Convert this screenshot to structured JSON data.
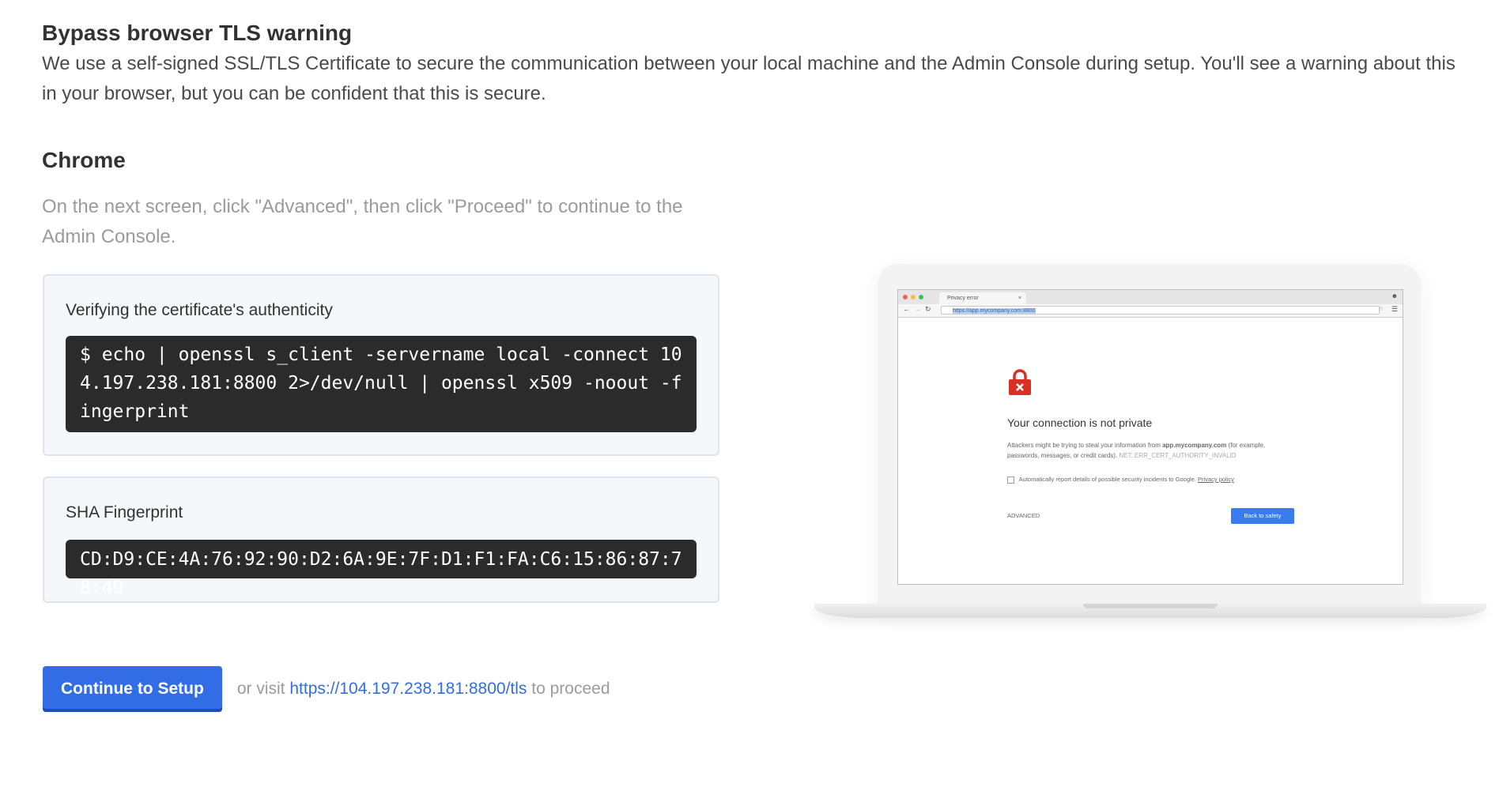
{
  "header": {
    "title": "Bypass browser TLS warning",
    "intro": "We use a self-signed SSL/TLS Certificate to secure the communication between your local machine and the Admin Console during setup. You'll see a warning about this in your browser, but you can be confident that this is secure."
  },
  "browser_section": {
    "title": "Chrome",
    "instructions": "On the next screen, click \"Advanced\", then click \"Proceed\" to continue to the Admin Console."
  },
  "verify_card": {
    "title": "Verifying the certificate's authenticity",
    "command": "$ echo | openssl s_client -servername local -connect 104.197.238.181:8800 2>/dev/null | openssl x509 -noout -fingerprint"
  },
  "fingerprint_card": {
    "title": "SHA Fingerprint",
    "value": "CD:D9:CE:4A:76:92:90:D2:6A:9E:7F:D1:F1:FA:C6:15:86:87:78:49"
  },
  "actions": {
    "continue_label": "Continue to Setup",
    "or_visit": "or visit",
    "link_text": "https://104.197.238.181:8800/tls",
    "to_proceed": "to proceed"
  },
  "illustration": {
    "tab_title": "Privacy error",
    "tab_close": "×",
    "url": "https://app.mycompany.com:8800",
    "error_title": "Your connection is not private",
    "error_text_pre": "Attackers might be trying to steal your information from",
    "error_domain": "app.mycompany.com",
    "error_text_post": "(for example, passwords, messages, or credit cards).",
    "error_code": "NET::ERR_CERT_AUTHORITY_INVALID",
    "checkbox_label": "Automatically report details of possible security incidents to Google.",
    "privacy_link": "Privacy policy",
    "advanced_label": "ADVANCED",
    "back_button": "Back to safety"
  },
  "colors": {
    "primary": "#326de6",
    "code_bg": "#2b2b2b",
    "card_bg": "#f5f8fb",
    "error_red": "#d93025"
  }
}
